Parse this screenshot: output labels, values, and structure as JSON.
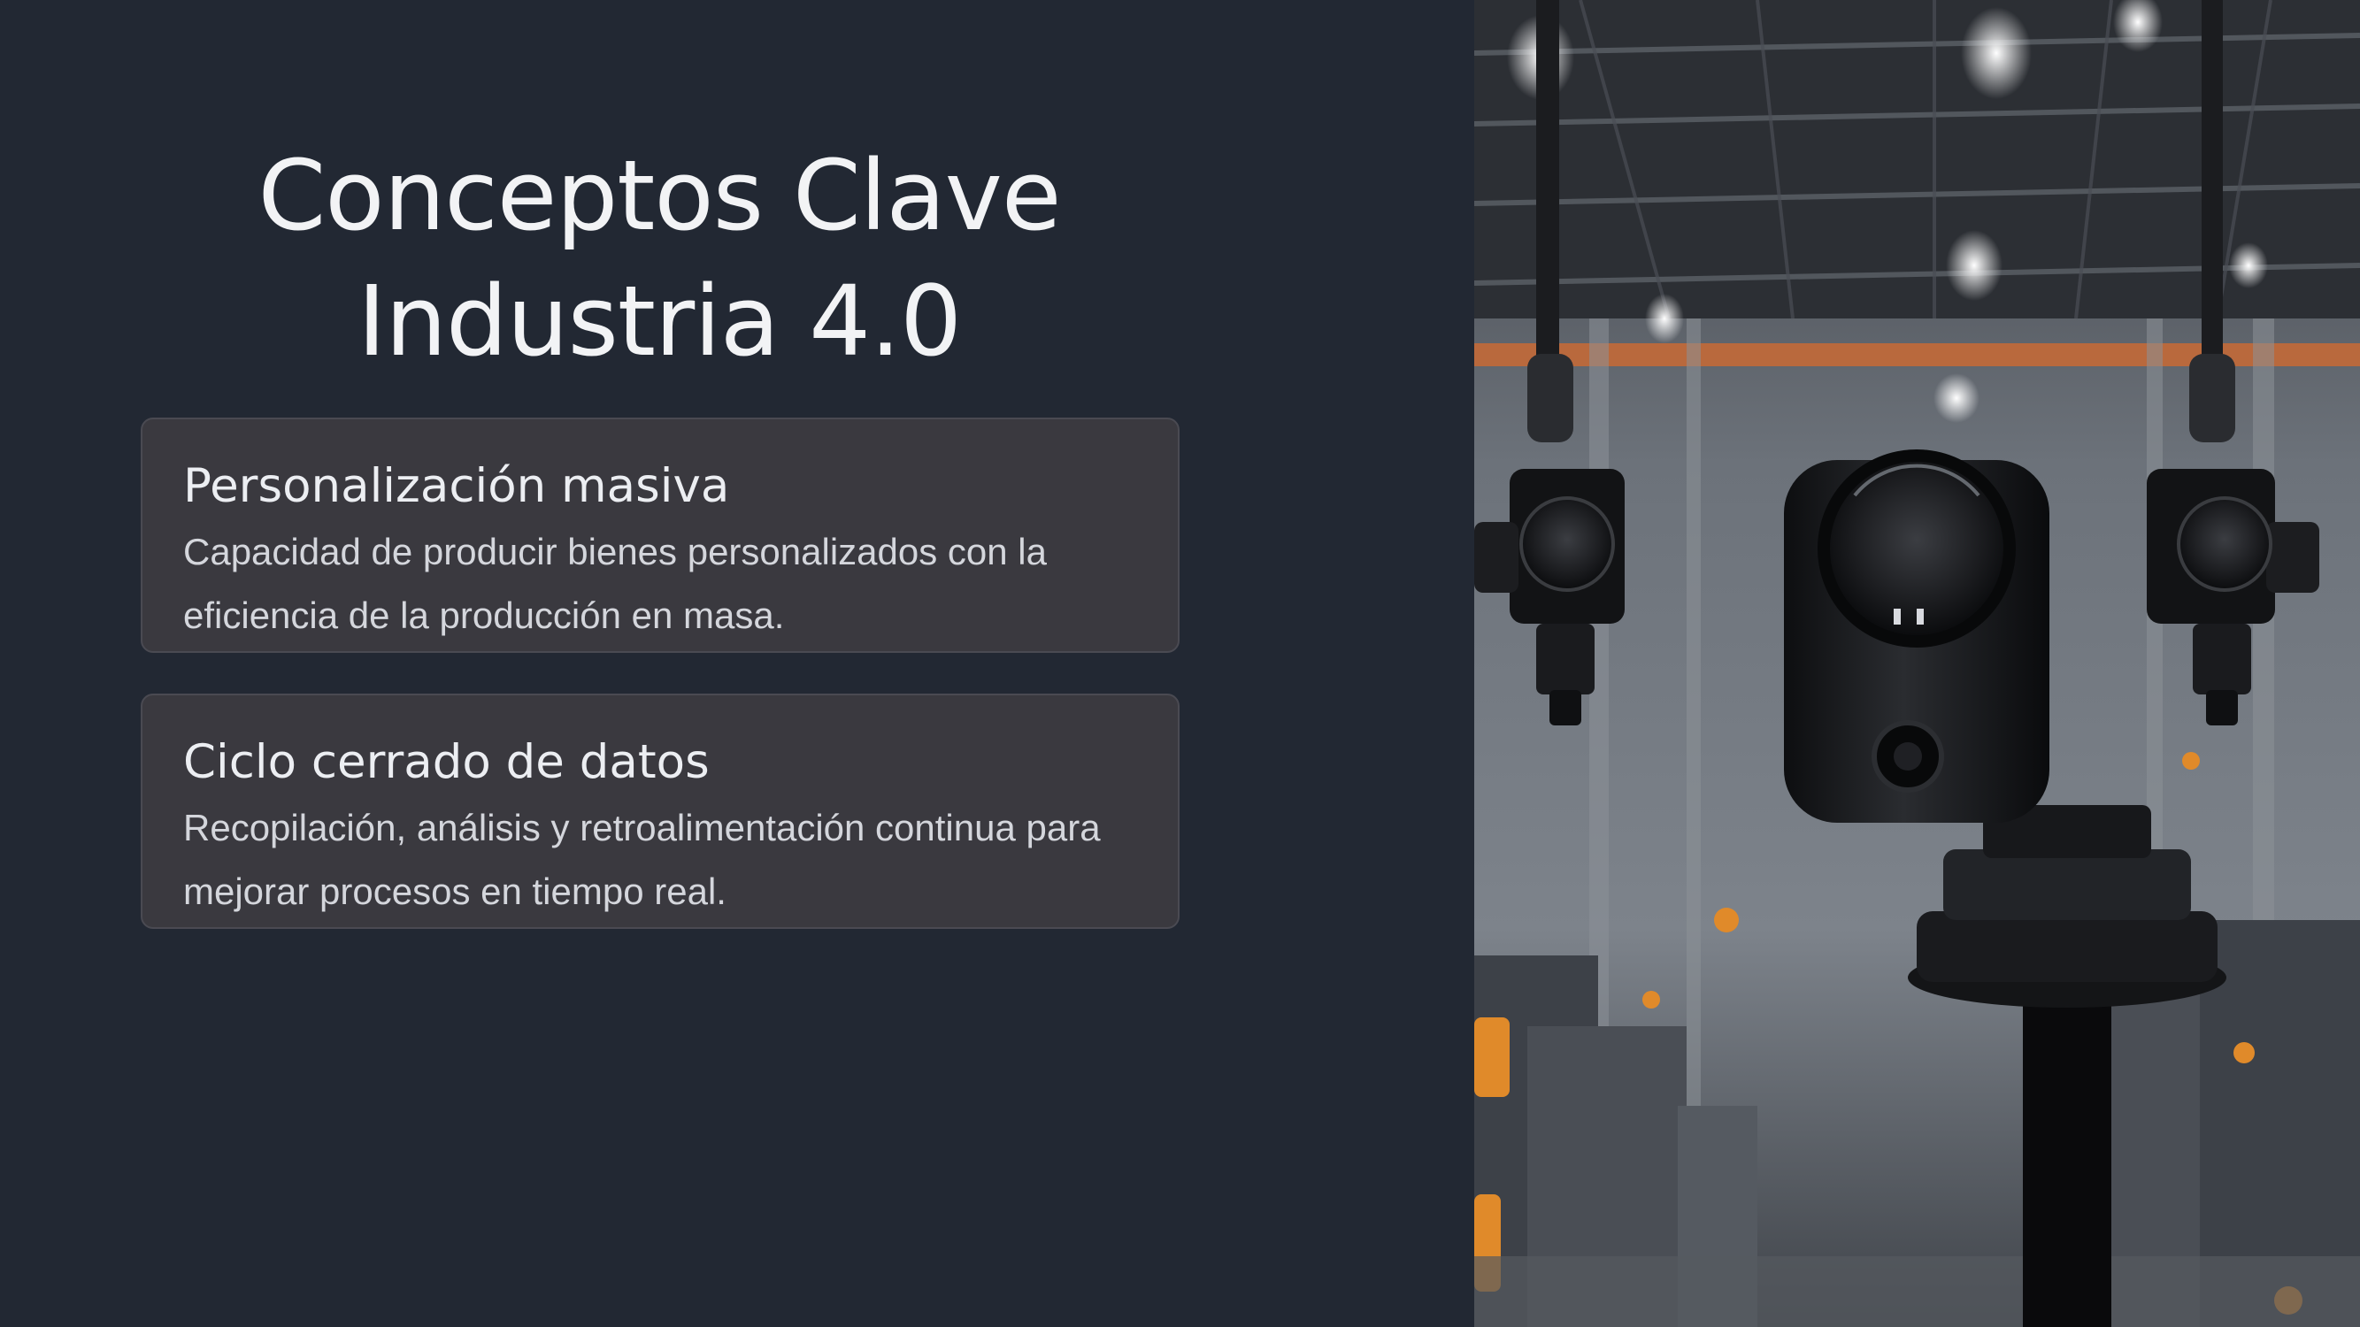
{
  "slide": {
    "title_line_1": "Conceptos Clave",
    "title_line_2": "Industria 4.0"
  },
  "cards": [
    {
      "heading": "Personalización masiva",
      "body": "Capacidad de producir bienes personalizados con la eficiencia de la producción en masa."
    },
    {
      "heading": "Ciclo cerrado de datos",
      "body": "Recopilación, análisis y retroalimentación continua para mejorar procesos en tiempo real."
    }
  ],
  "image": {
    "subject": "industrial-camera-sensors-in-factory"
  },
  "colors": {
    "background": "#222833",
    "card_background": "#3a393f",
    "title_text": "#f2f3f5",
    "accent_orange": "#d2703a"
  }
}
